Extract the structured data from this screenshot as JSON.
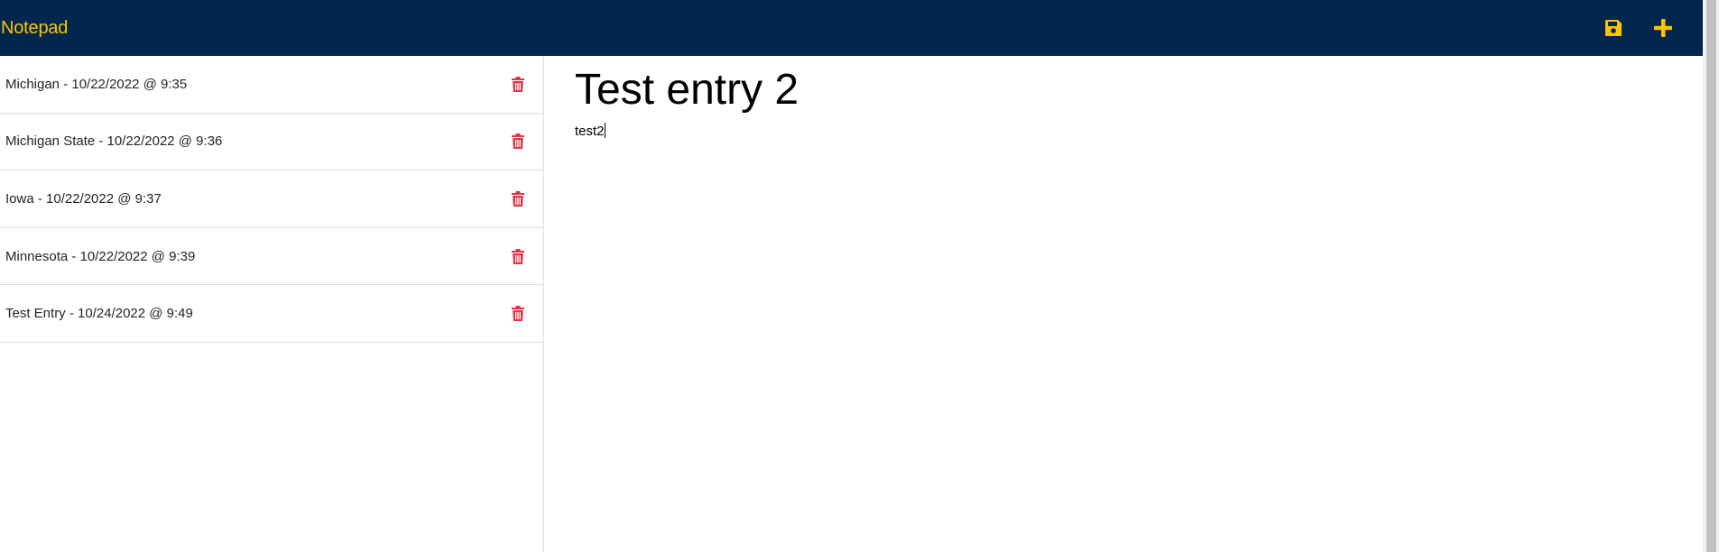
{
  "header": {
    "brand": "Notepad",
    "save_icon": "floppy-disk-icon",
    "add_icon": "plus-icon"
  },
  "colors": {
    "navbar_bg": "#00264d",
    "accent": "#ffc600",
    "delete": "#dc3545"
  },
  "sidebar": {
    "notes": [
      {
        "label": "Michigan - 10/22/2022 @ 9:35",
        "delete_icon": "trash-icon"
      },
      {
        "label": "Michigan State - 10/22/2022 @ 9:36",
        "delete_icon": "trash-icon"
      },
      {
        "label": "Iowa - 10/22/2022 @ 9:37",
        "delete_icon": "trash-icon"
      },
      {
        "label": "Minnesota - 10/22/2022 @ 9:39",
        "delete_icon": "trash-icon"
      },
      {
        "label": "Test Entry - 10/24/2022 @ 9:49",
        "delete_icon": "trash-icon"
      }
    ]
  },
  "editor": {
    "title": "Test entry 2",
    "body": "test2"
  }
}
